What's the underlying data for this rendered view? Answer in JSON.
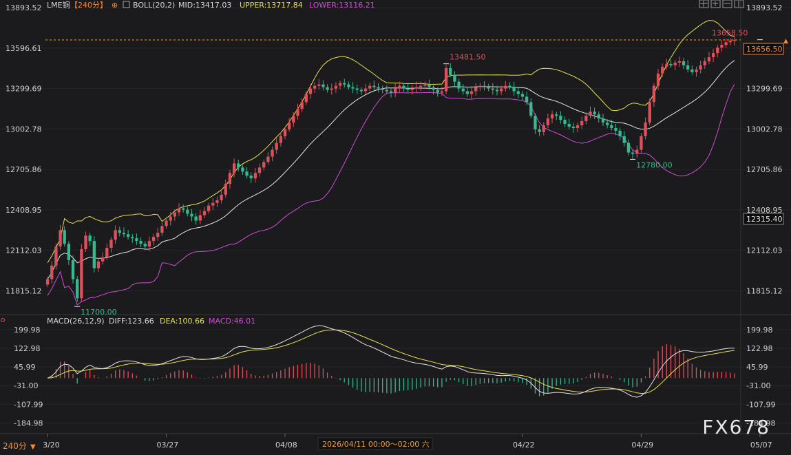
{
  "header": {
    "symbol": "LME铜",
    "period": "【240分】",
    "indicator": "BOLL(20,2)",
    "mid": "MID:13417.03",
    "upper": "UPPER:13717.84",
    "lower": "LOWER:13116.21"
  },
  "macd_header": {
    "indicator": "MACD(26,12,9)",
    "diff": "DIFF:123.66",
    "dea": "DEA:100.66",
    "macd": "MACD:46.01"
  },
  "price_axis_labels": [
    "13893.52",
    "13596.61",
    "13299.69",
    "13002.78",
    "12705.86",
    "12408.95",
    "12112.03",
    "11815.12"
  ],
  "macd_axis_labels": [
    "199.98",
    "122.98",
    "45.99",
    "-31.00",
    "-107.99",
    "-184.98"
  ],
  "date_labels": [
    "03/20",
    "03/27",
    "04/08",
    "04/22",
    "04/29",
    "05/07"
  ],
  "crosshair_date": "2026/04/11  00:00～02:00 六",
  "period_tag": "240分",
  "last_price": "13656.50",
  "cursor_price": "12315.40",
  "annotations": {
    "high_recent": "13658.50",
    "high_mid": "13481.50",
    "low_mid": "12780.00",
    "low_start": "11700.00"
  },
  "watermark": "FX678",
  "colors": {
    "up": "#e0505a",
    "down": "#39b88f",
    "mid": "#e6e6e6",
    "upper": "#e7e34a",
    "lower": "#d24bd6",
    "macd_diff": "#e6e6e6",
    "macd_dea": "#e7e34a",
    "accent": "#f0a040"
  },
  "chart_data": [
    {
      "type": "candlestick",
      "title": "LME铜【240分】",
      "ylim": [
        11650,
        13950
      ],
      "y_ticks": [
        13893.52,
        13596.61,
        13299.69,
        13002.78,
        12705.86,
        12408.95,
        12112.03,
        11815.12
      ],
      "x_labels": [
        "03/20",
        "03/27",
        "04/08",
        "04/22",
        "04/29",
        "05/07"
      ],
      "x_label_positions": [
        0,
        28,
        56,
        112,
        140,
        168
      ],
      "close": [
        11900,
        12000,
        12140,
        12260,
        12160,
        12040,
        11900,
        11760,
        12120,
        12220,
        12180,
        11980,
        12030,
        12060,
        12130,
        12190,
        12260,
        12240,
        12230,
        12210,
        12200,
        12180,
        12160,
        12140,
        12180,
        12210,
        12240,
        12290,
        12330,
        12360,
        12390,
        12420,
        12410,
        12380,
        12360,
        12330,
        12370,
        12400,
        12440,
        12460,
        12480,
        12520,
        12600,
        12680,
        12750,
        12720,
        12690,
        12660,
        12640,
        12680,
        12720,
        12760,
        12800,
        12850,
        12900,
        12950,
        13000,
        13050,
        13100,
        13150,
        13200,
        13260,
        13300,
        13320,
        13330,
        13310,
        13290,
        13300,
        13320,
        13340,
        13330,
        13310,
        13300,
        13290,
        13280,
        13300,
        13320,
        13310,
        13300,
        13290,
        13280,
        13270,
        13300,
        13320,
        13300,
        13290,
        13300,
        13310,
        13320,
        13330,
        13310,
        13290,
        13270,
        13280,
        13450,
        13400,
        13350,
        13300,
        13280,
        13260,
        13280,
        13310,
        13320,
        13310,
        13300,
        13290,
        13280,
        13300,
        13320,
        13310,
        13280,
        13260,
        13240,
        13200,
        13100,
        13000,
        12980,
        13030,
        13080,
        13110,
        13100,
        13070,
        13040,
        13020,
        13010,
        13030,
        13060,
        13100,
        13130,
        13110,
        13080,
        13050,
        13030,
        13010,
        12990,
        12950,
        12900,
        12830,
        12820,
        12850,
        12950,
        13050,
        13200,
        13320,
        13410,
        13460,
        13480,
        13470,
        13490,
        13500,
        13470,
        13440,
        13420,
        13440,
        13470,
        13500,
        13530,
        13560,
        13600,
        13620,
        13640,
        13650,
        13656.5
      ],
      "series": [
        {
          "name": "MID",
          "last": 13417.03
        },
        {
          "name": "UPPER",
          "last": 13717.84
        },
        {
          "name": "LOWER",
          "last": 13116.21
        }
      ],
      "annotations": [
        {
          "label": "11700.00",
          "index": 7,
          "value": 11700
        },
        {
          "label": "13481.50",
          "index": 94,
          "value": 13481.5
        },
        {
          "label": "12780.00",
          "index": 138,
          "value": 12780
        },
        {
          "label": "13658.50",
          "index": 168,
          "value": 13658.5
        }
      ],
      "last_price": 13656.5,
      "cursor_price": 12315.4
    },
    {
      "type": "line",
      "title": "MACD(26,12,9)",
      "ylim": [
        -215,
        225
      ],
      "y_ticks": [
        199.98,
        122.98,
        45.99,
        -31.0,
        -107.99,
        -184.98
      ],
      "series": [
        {
          "name": "DIFF",
          "last": 123.66
        },
        {
          "name": "DEA",
          "last": 100.66
        },
        {
          "name": "MACD",
          "last": 46.01
        }
      ]
    }
  ]
}
